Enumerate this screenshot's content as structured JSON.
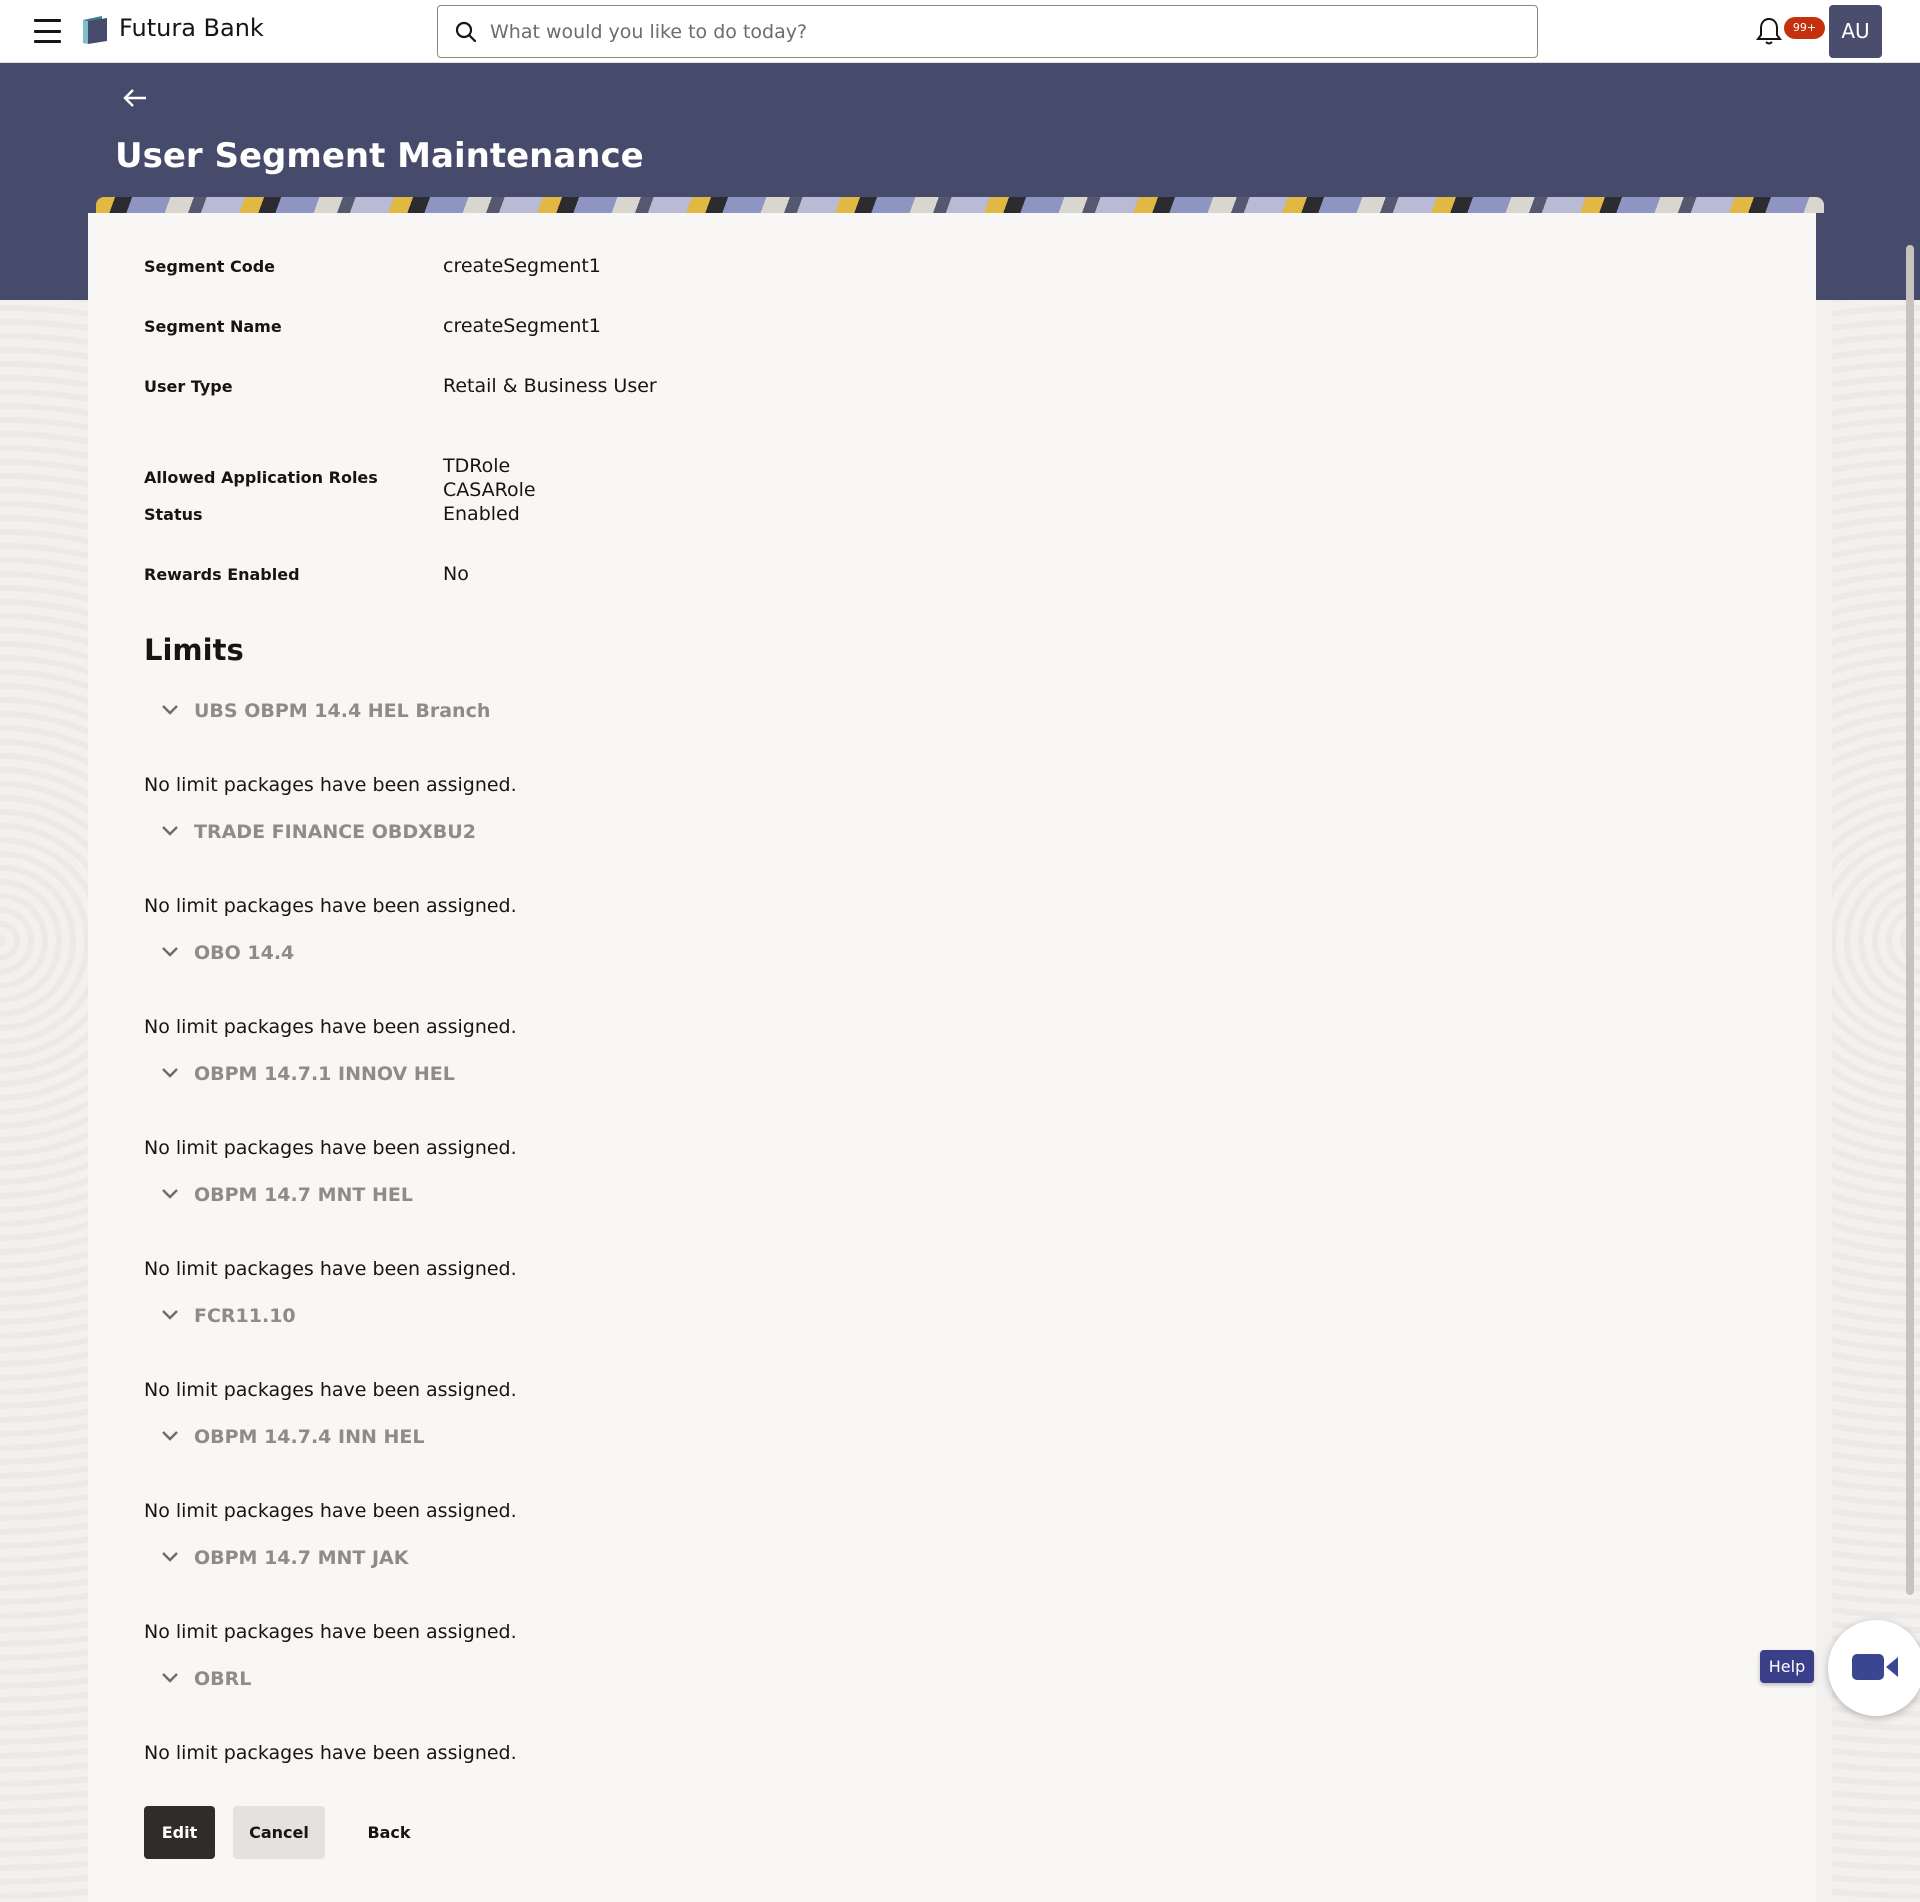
{
  "header": {
    "brand": "Futura Bank",
    "search_placeholder": "What would you like to do today?",
    "notification_badge": "99+",
    "avatar_initials": "AU"
  },
  "page": {
    "title": "User Segment Maintenance"
  },
  "details": [
    {
      "label": "Segment Code",
      "value": "createSegment1"
    },
    {
      "label": "Segment Name",
      "value": "createSegment1"
    },
    {
      "label": "User Type",
      "value": "Retail & Business User"
    },
    {
      "label": "Allowed Application Roles",
      "values": [
        "TDRole",
        "CASARole"
      ]
    },
    {
      "label": "Status",
      "value": "Enabled"
    },
    {
      "label": "Rewards Enabled",
      "value": "No"
    }
  ],
  "limits": {
    "title": "Limits",
    "items": [
      {
        "name": "UBS OBPM 14.4 HEL Branch",
        "message": "No limit packages have been assigned."
      },
      {
        "name": "TRADE FINANCE OBDXBU2",
        "message": "No limit packages have been assigned."
      },
      {
        "name": "OBO 14.4",
        "message": "No limit packages have been assigned."
      },
      {
        "name": "OBPM 14.7.1 INNOV HEL",
        "message": "No limit packages have been assigned."
      },
      {
        "name": "OBPM 14.7 MNT HEL",
        "message": "No limit packages have been assigned."
      },
      {
        "name": "FCR11.10",
        "message": "No limit packages have been assigned."
      },
      {
        "name": "OBPM 14.7.4 INN HEL",
        "message": "No limit packages have been assigned."
      },
      {
        "name": "OBPM 14.7 MNT JAK",
        "message": "No limit packages have been assigned."
      },
      {
        "name": "OBRL",
        "message": "No limit packages have been assigned."
      }
    ]
  },
  "actions": {
    "edit": "Edit",
    "cancel": "Cancel",
    "back": "Back"
  },
  "help_label": "Help",
  "colors": {
    "band": "#474b6b",
    "avatar": "#4a4d6e",
    "badge": "#c3310f",
    "primary_button": "#2f2c2a",
    "help": "#3b3f8a"
  }
}
